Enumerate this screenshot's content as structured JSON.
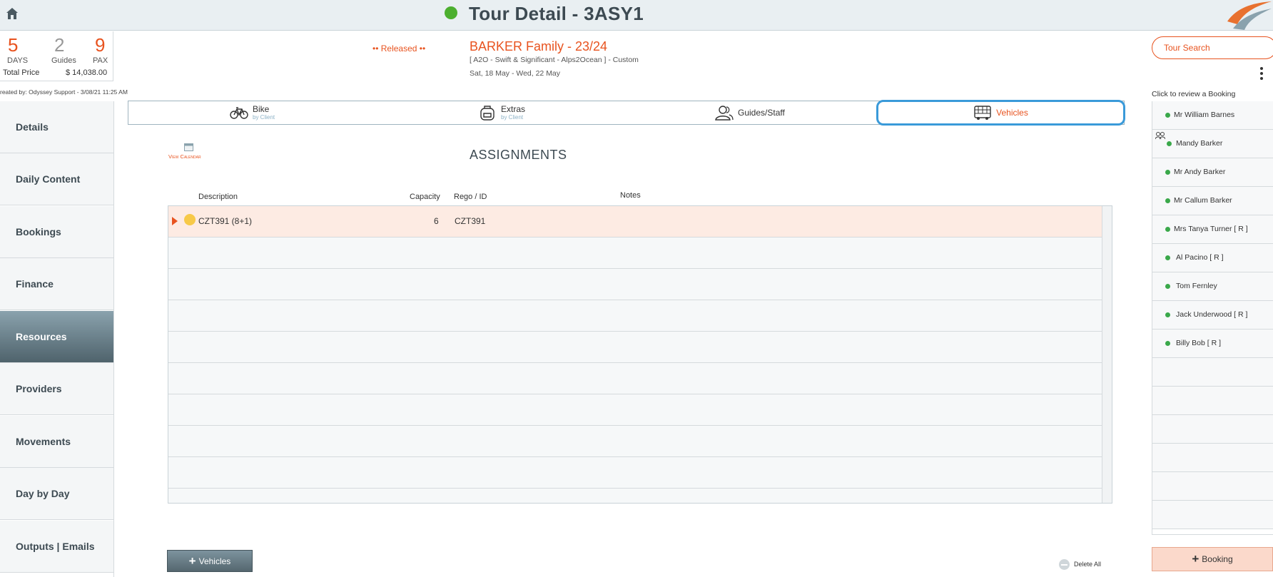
{
  "header": {
    "title": "Tour Detail - 3ASY1",
    "status_color": "#4caf2f",
    "home_icon": "home-icon",
    "logo": "brand-swoosh-logo"
  },
  "stats": {
    "days": {
      "value": "5",
      "label": "DAYS"
    },
    "guides": {
      "value": "2",
      "label": "Guides"
    },
    "pax": {
      "value": "9",
      "label": "PAX"
    },
    "total_price_label": "Total Price",
    "total_price_value": "$ 14,038.00",
    "created_by": "reated by: Odyssey Support - 3/08/21 11:25 AM"
  },
  "tour": {
    "status": "•• Released ••",
    "name": "BARKER Family - 23/24",
    "subtitle": "[ A2O - Swift & Significant - Alps2Ocean ] - Custom",
    "dates": "Sat, 18 May  - Wed, 22 May"
  },
  "sidebar": {
    "items": [
      {
        "label": "Details",
        "active": false
      },
      {
        "label": "Daily Content",
        "active": false
      },
      {
        "label": "Bookings",
        "active": false
      },
      {
        "label": "Finance",
        "active": false
      },
      {
        "label": "Resources",
        "active": true
      },
      {
        "label": "Providers",
        "active": false
      },
      {
        "label": "Movements",
        "active": false
      },
      {
        "label": "Day by Day",
        "active": false
      },
      {
        "label": "Outputs | Emails",
        "active": false
      }
    ]
  },
  "tabs": [
    {
      "label": "Bike",
      "sub": "by Client",
      "icon": "bicycle-icon"
    },
    {
      "label": "Extras",
      "sub": "by Client",
      "icon": "backpack-icon"
    },
    {
      "label": "Guides/Staff",
      "sub": "",
      "icon": "people-icon"
    },
    {
      "label": "Vehicles",
      "sub": "",
      "icon": "bus-icon",
      "selected": true
    }
  ],
  "assignments": {
    "title": "ASSIGNMENTS",
    "view_calendar": "View Calendar",
    "columns": {
      "description": "Description",
      "capacity": "Capacity",
      "rego": "Rego / ID",
      "notes": "Notes"
    },
    "rows": [
      {
        "description": "CZT391 (8+1)",
        "capacity": "6",
        "rego": "CZT391",
        "notes": "",
        "status_color": "#f7c948"
      }
    ],
    "add_button": "Vehicles",
    "delete_all": "Delete All"
  },
  "right_panel": {
    "search_label": "Tour Search",
    "review_hint": "Click to review a Booking",
    "bookings": [
      "Mr William Barnes",
      "Mandy Barker",
      "Mr Andy Barker",
      "Mr Callum Barker",
      "Mrs Tanya Turner  [ R ]",
      "Al Pacino  [ R ]",
      "Tom Fernley",
      "Jack Underwood  [ R ]",
      "Billy Bob  [ R ]"
    ],
    "add_booking": "Booking"
  },
  "colors": {
    "accent": "#e8531f",
    "selected_tab_border": "#3a9ad9",
    "active_nav": "#5b6f78",
    "booking_dot": "#3aa84a"
  }
}
